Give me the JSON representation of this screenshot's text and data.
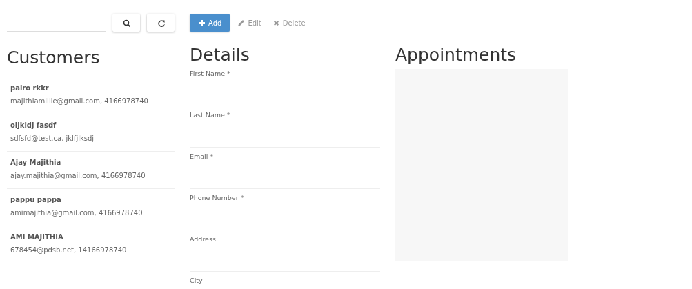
{
  "search": {
    "buttons": [
      {
        "kind": "search"
      },
      {
        "kind": "refresh"
      }
    ]
  },
  "toolbar": [
    {
      "kind": "add",
      "label": "Add",
      "disabled": false
    },
    {
      "kind": "edit",
      "label": "Edit",
      "disabled": true
    },
    {
      "kind": "delete",
      "label": "Delete",
      "disabled": true
    }
  ],
  "customers": {
    "title": "Customers",
    "items": [
      {
        "name": "pairo rkkr",
        "detail": "majithiamillie@gmail.com, 4166978740"
      },
      {
        "name": "oijkldj fasdf",
        "detail": "sdfsfd@test.ca, jklfjlksdj"
      },
      {
        "name": "Ajay Majithia",
        "detail": "ajay.majithia@gmail.com, 4166978740"
      },
      {
        "name": "pappu pappa",
        "detail": "amimajithia@gmail.com, 4166978740"
      },
      {
        "name": "AMI MAJITHIA",
        "detail": "678454@pdsb.net, 14166978740"
      }
    ]
  },
  "details": {
    "title": "Details",
    "fields": [
      {
        "label": "First Name *"
      },
      {
        "label": "Last Name *"
      },
      {
        "label": "Email *"
      },
      {
        "label": "Phone Number *"
      },
      {
        "label": "Address"
      },
      {
        "label": "City"
      }
    ]
  },
  "appointments": {
    "title": "Appointments"
  }
}
